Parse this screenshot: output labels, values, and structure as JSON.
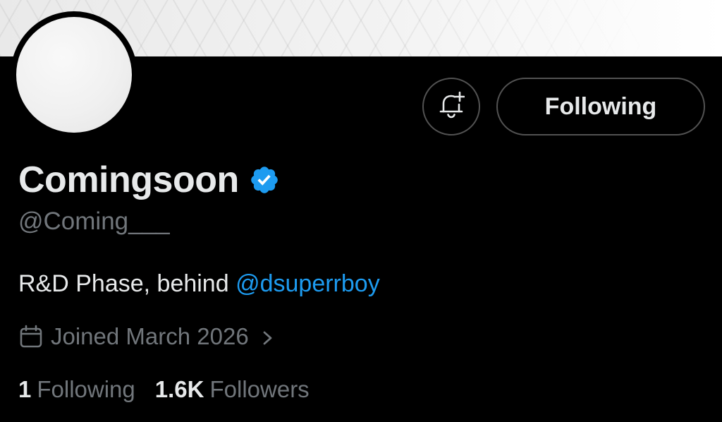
{
  "profile": {
    "display_name": "Comingsoon",
    "handle": "@Coming___",
    "verified": true,
    "verified_badge_color": "#1d9bf0",
    "bio_text": "R&D Phase, behind ",
    "bio_mention": "@dsuperrboy",
    "joined": "Joined March 2026"
  },
  "actions": {
    "notify_icon": "bell-plus-icon",
    "follow_label": "Following"
  },
  "stats": {
    "following_count": "1",
    "following_label": "Following",
    "followers_count": "1.6K",
    "followers_label": "Followers"
  },
  "colors": {
    "background": "#000000",
    "primary_text": "#e7e9ea",
    "secondary_text": "#71767b",
    "link": "#1d9bf0",
    "button_border": "#525252"
  }
}
